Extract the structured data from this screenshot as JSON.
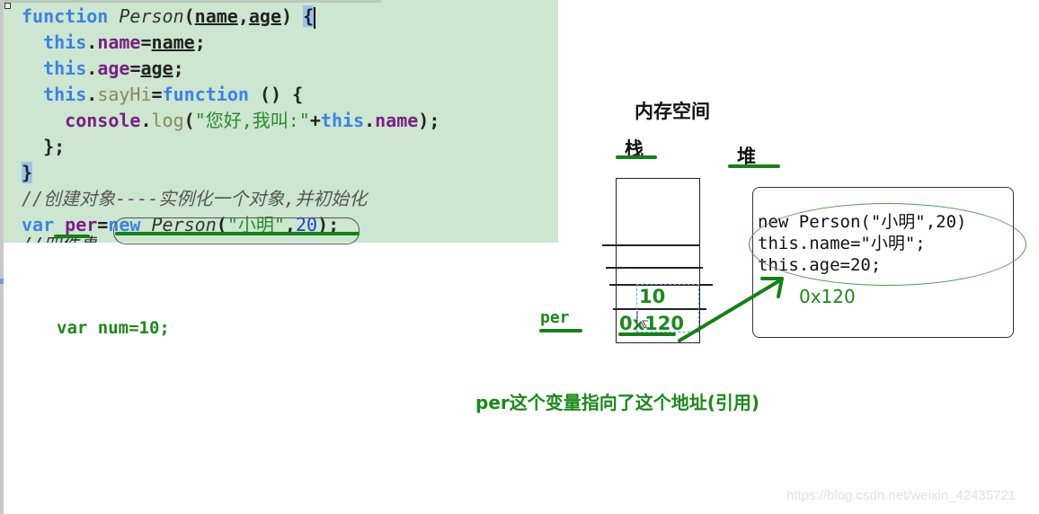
{
  "code_editor": {
    "lines": [
      {
        "tokens": [
          {
            "t": "function",
            "c": "kw"
          },
          {
            "t": " "
          },
          {
            "t": "Person",
            "c": "fn"
          },
          {
            "t": "("
          },
          {
            "t": "name",
            "c": "param"
          },
          {
            "t": ","
          },
          {
            "t": "age",
            "c": "param"
          },
          {
            "t": ") "
          },
          {
            "t": "{",
            "c": "brace-hl"
          }
        ]
      },
      {
        "tokens": [
          {
            "t": "  "
          },
          {
            "t": "this",
            "c": "kw"
          },
          {
            "t": "."
          },
          {
            "t": "name",
            "c": "prop"
          },
          {
            "t": "="
          },
          {
            "t": "name",
            "c": "param"
          },
          {
            "t": ";"
          }
        ]
      },
      {
        "tokens": [
          {
            "t": "  "
          },
          {
            "t": "this",
            "c": "kw"
          },
          {
            "t": "."
          },
          {
            "t": "age",
            "c": "prop"
          },
          {
            "t": "="
          },
          {
            "t": "age",
            "c": "param"
          },
          {
            "t": ";"
          }
        ]
      },
      {
        "tokens": [
          {
            "t": "  "
          },
          {
            "t": "this",
            "c": "kw"
          },
          {
            "t": "."
          },
          {
            "t": "sayHi",
            "c": "method"
          },
          {
            "t": "="
          },
          {
            "t": "function",
            "c": "kw"
          },
          {
            "t": " () {"
          }
        ]
      },
      {
        "tokens": [
          {
            "t": "    "
          },
          {
            "t": "console",
            "c": "prop"
          },
          {
            "t": "."
          },
          {
            "t": "log",
            "c": "method"
          },
          {
            "t": "("
          },
          {
            "t": "\"您好,我叫:\"",
            "c": "str"
          },
          {
            "t": "+"
          },
          {
            "t": "this",
            "c": "kw"
          },
          {
            "t": "."
          },
          {
            "t": "name",
            "c": "prop"
          },
          {
            "t": ");"
          }
        ]
      },
      {
        "tokens": [
          {
            "t": "  };"
          }
        ]
      },
      {
        "tokens": [
          {
            "t": "}",
            "c": "brace-hl"
          }
        ]
      },
      {
        "tokens": [
          {
            "t": "//创建对象----实例化一个对象,并初始化",
            "c": "cmt"
          }
        ]
      },
      {
        "tokens": [
          {
            "t": "var",
            "c": "kw"
          },
          {
            "t": " "
          },
          {
            "t": "per",
            "c": "prop"
          },
          {
            "t": "="
          },
          {
            "t": "new",
            "c": "kw"
          },
          {
            "t": " "
          },
          {
            "t": "Person",
            "c": "fn"
          },
          {
            "t": "("
          },
          {
            "t": "\"小明\"",
            "c": "str"
          },
          {
            "t": ","
          },
          {
            "t": "20",
            "c": "num"
          },
          {
            "t": ");"
          }
        ]
      }
    ],
    "cut_line": "//四件事"
  },
  "annotations": {
    "var_num": "var num=10;",
    "memory_title": "内存空间",
    "stack_label": "栈",
    "heap_label": "堆",
    "per_label": "per",
    "stack_value_num": "10",
    "stack_value_addr": "0x120",
    "heap_lines": [
      "new Person(\"小明\",20)",
      "this.name=\"小明\";",
      "this.age=20;"
    ],
    "heap_address": "0x120",
    "caption": "per这个变量指向了这个地址(引用)",
    "watermark": "https://blog.csdn.net/weixin_42435721"
  },
  "colors": {
    "annotation_green": "#148214",
    "code_background": "#cce6cf",
    "keyword_blue": "#3b82e8"
  }
}
